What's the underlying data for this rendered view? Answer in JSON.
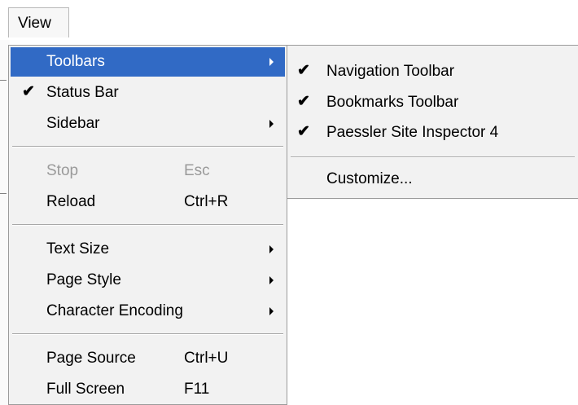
{
  "menubar": {
    "view_label": "View"
  },
  "menu": {
    "toolbars": "Toolbars",
    "status_bar": "Status Bar",
    "sidebar": "Sidebar",
    "stop": "Stop",
    "stop_key": "Esc",
    "reload": "Reload",
    "reload_key": "Ctrl+R",
    "text_size": "Text Size",
    "page_style": "Page Style",
    "character_encoding": "Character Encoding",
    "page_source": "Page Source",
    "page_source_key": "Ctrl+U",
    "full_screen": "Full Screen",
    "full_screen_key": "F11"
  },
  "submenu": {
    "navigation_toolbar": "Navigation Toolbar",
    "bookmarks_toolbar": "Bookmarks Toolbar",
    "paessler_site_inspector": "Paessler Site Inspector 4",
    "customize": "Customize..."
  },
  "colors": {
    "highlight": "#316ac5",
    "menu_bg": "#f2f2f2",
    "disabled": "#9a9a9a"
  },
  "glyphs": {
    "check": "✔"
  }
}
